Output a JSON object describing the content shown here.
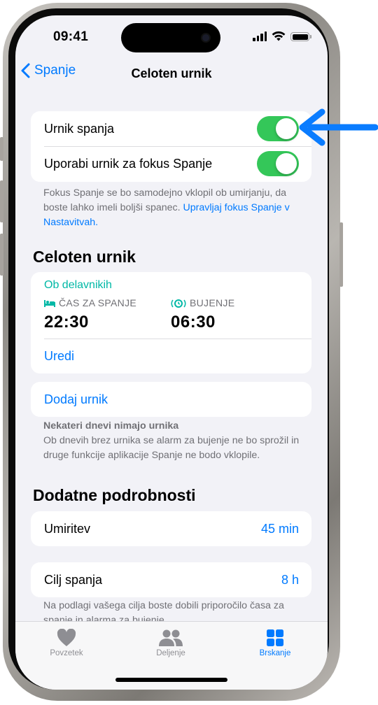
{
  "status_bar": {
    "time": "09:41"
  },
  "nav": {
    "back_label": "Spanje",
    "title": "Celoten urnik"
  },
  "sleep_schedule_card": {
    "rows": [
      {
        "label": "Urnik spanja",
        "toggle_on": true
      },
      {
        "label": "Uporabi urnik za fokus Spanje",
        "toggle_on": true
      }
    ]
  },
  "focus_note": {
    "text": "Fokus Spanje se bo samodejno vklopil ob umirjanju, da boste lahko imeli boljši spanec. ",
    "link": "Upravljaj fokus Spanje v Nastavitvah."
  },
  "full_schedule": {
    "heading": "Celoten urnik",
    "schedule": {
      "days_label": "Ob delavnikih",
      "bedtime_caption": "ČAS ZA SPANJE",
      "bedtime": "22:30",
      "wake_caption": "BUJENJE",
      "wake": "06:30",
      "edit_label": "Uredi"
    },
    "add_schedule_label": "Dodaj urnik",
    "note_title": "Nekateri dnevi nimajo urnika",
    "note_text": "Ob dnevih brez urnika se alarm za bujenje ne bo sprožil in druge funkcije aplikacije Spanje ne bodo vklopile."
  },
  "details": {
    "heading": "Dodatne podrobnosti",
    "wind_down_label": "Umiritev",
    "wind_down_value": "45 min",
    "sleep_goal_label": "Cilj spanja",
    "sleep_goal_value": "8 h",
    "goal_note": "Na podlagi vašega cilja boste dobili priporočilo časa za spanje in alarma za bujenje."
  },
  "tab_bar": {
    "tabs": [
      {
        "label": "Povzetek",
        "icon": "heart-icon",
        "active": false
      },
      {
        "label": "Deljenje",
        "icon": "people-icon",
        "active": false
      },
      {
        "label": "Brskanje",
        "icon": "grid-icon",
        "active": true
      }
    ]
  },
  "colors": {
    "accent": "#007aff",
    "toggle_on": "#34c759",
    "schedule_teal": "#00b8a6",
    "callout_arrow": "#0a7cff"
  }
}
